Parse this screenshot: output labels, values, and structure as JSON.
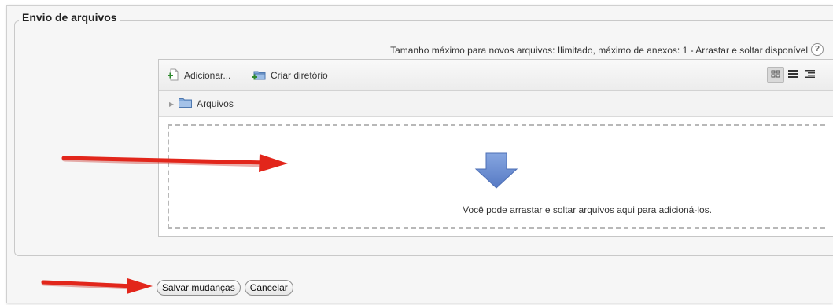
{
  "section": {
    "legend": "Envio de arquivos"
  },
  "filemanager": {
    "limits_text": "Tamanho máximo para novos arquivos: Ilimitado, máximo de anexos: 1 - Arrastar e soltar disponível",
    "help_icon_label": "?",
    "toolbar": {
      "add_label": "Adicionar...",
      "mkdir_label": "Criar diretório"
    },
    "path": {
      "folder_label": "Arquivos"
    },
    "dropzone": {
      "message": "Você pode arrastar e soltar arquivos aqui para adicioná-los."
    }
  },
  "buttons": {
    "save_label": "Salvar mudanças",
    "cancel_label": "Cancelar"
  },
  "colors": {
    "annotation_arrow": "#e2261b",
    "drop_arrow": "#6f8fd1"
  },
  "icons": {
    "add": "add-file-icon",
    "mkdir": "new-folder-icon",
    "folder": "folder-icon",
    "view_icons": "icon-view-icon",
    "view_list": "list-view-icon",
    "view_tree": "tree-view-icon",
    "drop": "down-arrow-icon",
    "help": "help-icon"
  }
}
